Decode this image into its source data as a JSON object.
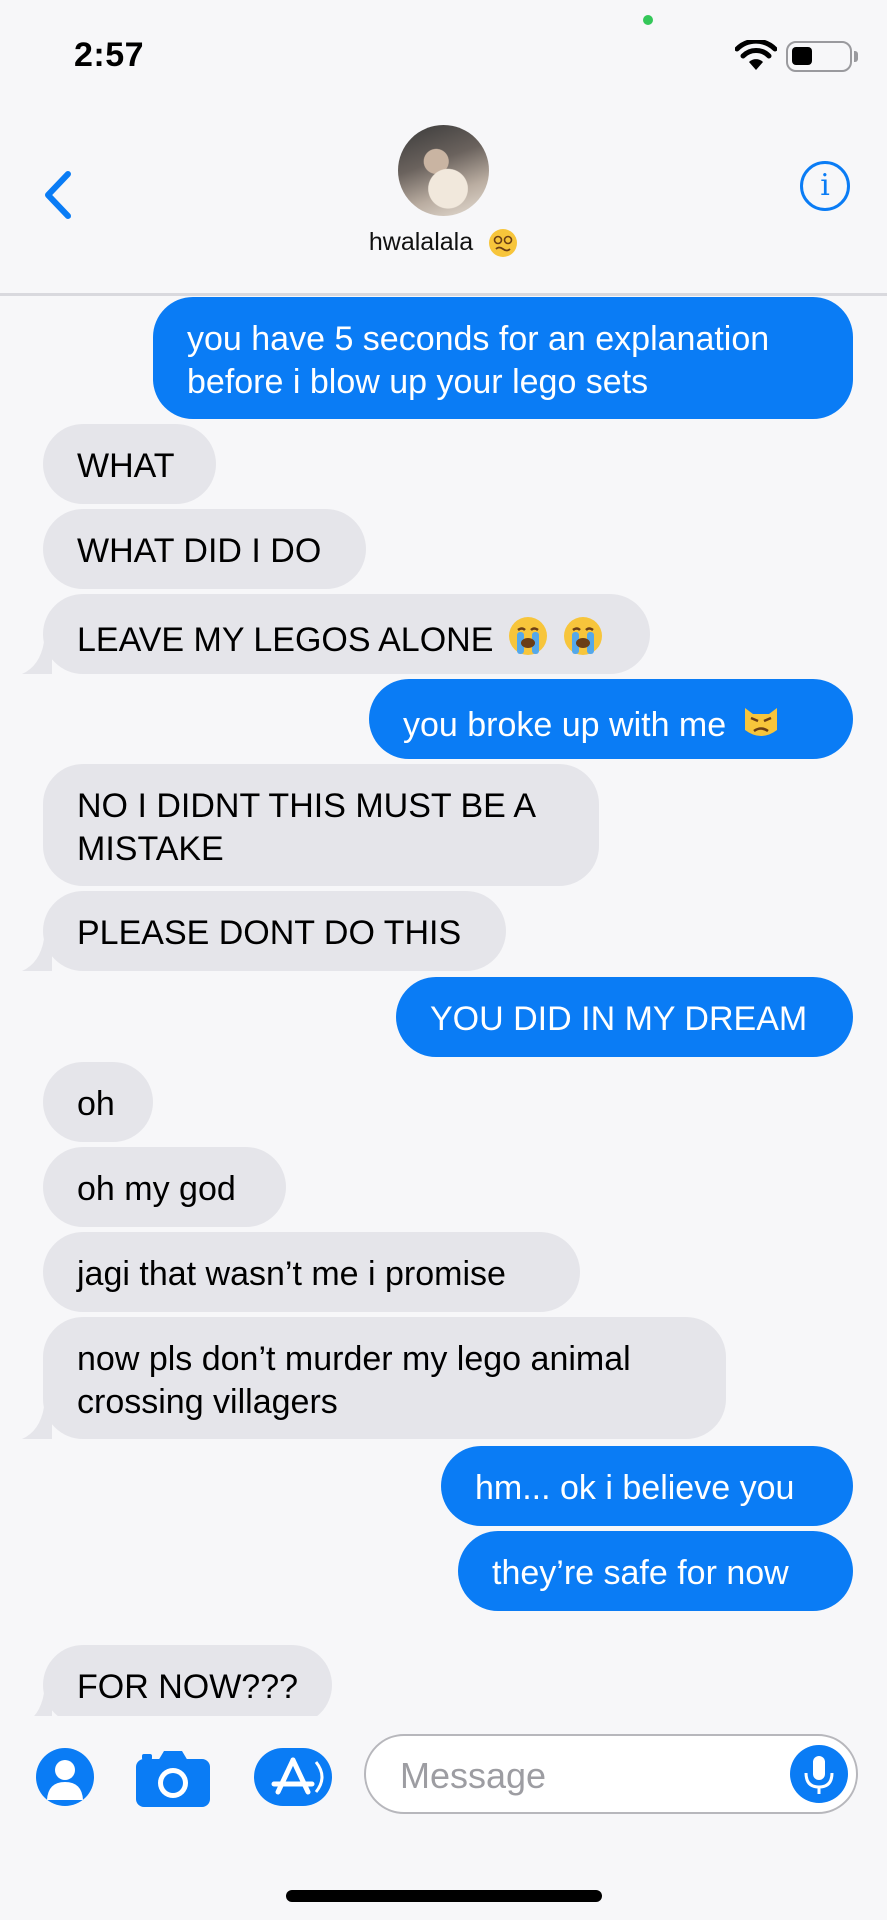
{
  "status_bar": {
    "time": "2:57"
  },
  "header": {
    "contact_name": "hwalalala"
  },
  "messages": [
    {
      "from": "me",
      "lines": [
        "you have 5 seconds for an explanation",
        "before i blow up your lego sets"
      ]
    },
    {
      "from": "them",
      "text": "WHAT"
    },
    {
      "from": "them",
      "text": "WHAT DID I DO"
    },
    {
      "from": "them",
      "text": "LEAVE MY LEGOS ALONE",
      "emoji": [
        "crying-face",
        "crying-face"
      ]
    },
    {
      "from": "me",
      "text": "you broke up with me",
      "emoji": [
        "angry-cat-face"
      ]
    },
    {
      "from": "them",
      "lines": [
        "NO I DIDNT THIS MUST BE A",
        "MISTAKE"
      ]
    },
    {
      "from": "them",
      "text": "PLEASE DONT DO THIS"
    },
    {
      "from": "me",
      "text": "YOU DID IN MY DREAM"
    },
    {
      "from": "them",
      "text": "oh"
    },
    {
      "from": "them",
      "text": "oh my god"
    },
    {
      "from": "them",
      "text": "jagi that wasn’t me i promise"
    },
    {
      "from": "them",
      "lines": [
        "now pls don’t murder my lego animal",
        "crossing villagers"
      ]
    },
    {
      "from": "me",
      "text": "hm... ok i believe you"
    },
    {
      "from": "me",
      "text": "they’re safe for now"
    },
    {
      "from": "them",
      "text": "FOR NOW???"
    }
  ],
  "input_bar": {
    "placeholder": "Message"
  },
  "icons": {
    "back": "chevron-left-icon",
    "info": "info-icon",
    "contact": "person-icon",
    "camera": "camera-icon",
    "apps": "app-store-icon",
    "mic": "microphone-icon"
  },
  "colors": {
    "accent": "#0a7cf5",
    "incoming_bubble": "#e5e5ea",
    "background": "#f7f7f9"
  }
}
